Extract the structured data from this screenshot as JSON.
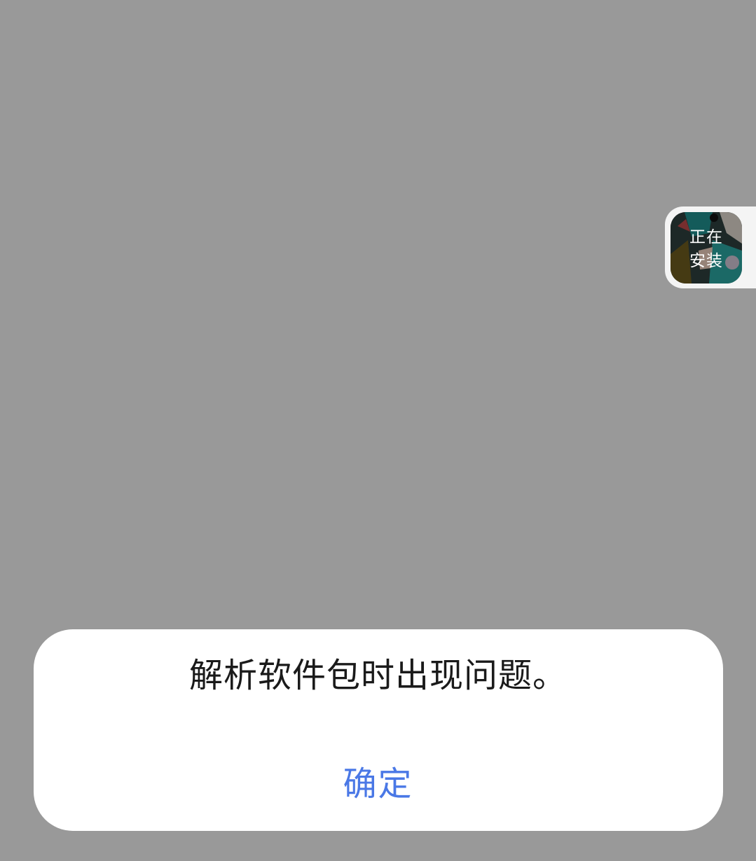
{
  "floating_installer": {
    "icon": "app-icon",
    "status_line1": "正在",
    "status_line2": "安装"
  },
  "dialog": {
    "message": "解析软件包时出现问题。",
    "confirm_label": "确定"
  },
  "colors": {
    "backdrop": "#999999",
    "dialog_bg": "#ffffff",
    "accent": "#4a78e6",
    "text": "#1a1a1a"
  }
}
